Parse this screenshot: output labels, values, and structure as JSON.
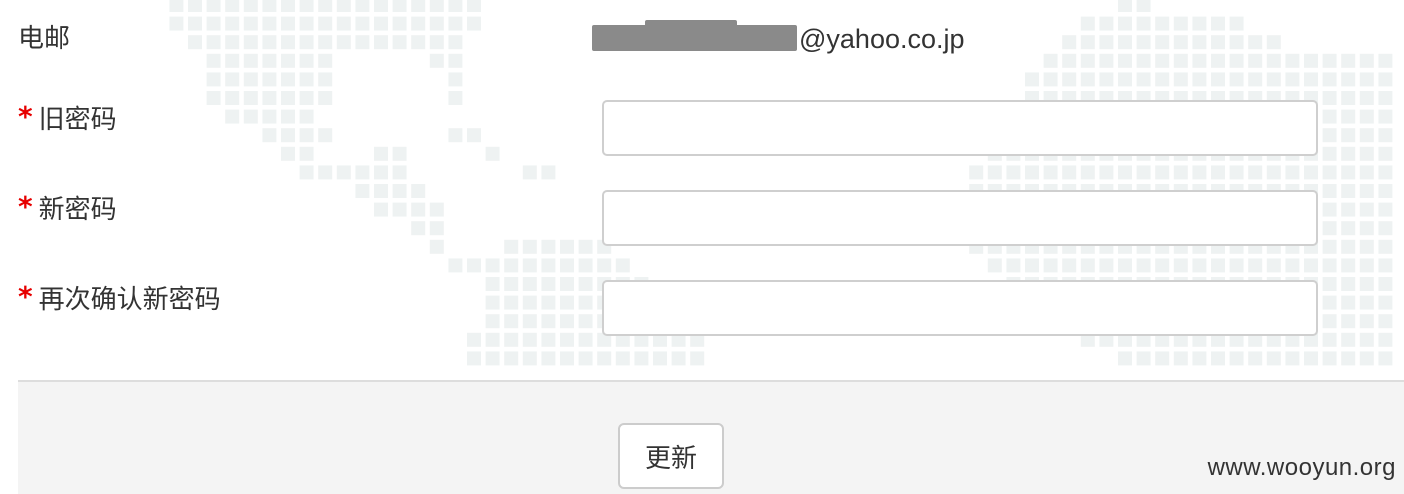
{
  "form": {
    "email": {
      "label": "电邮",
      "value_visible_suffix": "@yahoo.co.jp"
    },
    "old_password": {
      "required_mark": "*",
      "label": "旧密码",
      "value": ""
    },
    "new_password": {
      "required_mark": "*",
      "label": "新密码",
      "value": ""
    },
    "confirm_password": {
      "required_mark": "*",
      "label": "再次确认新密码",
      "value": ""
    }
  },
  "footer": {
    "update_button_label": "更新"
  },
  "watermark": "www.wooyun.org",
  "colors": {
    "required": "#e60000",
    "text": "#333333",
    "field_border": "#cfcfcf",
    "footer_bg": "#f4f4f4",
    "background_pattern": "#eef2f2",
    "redaction": "#8a8a8a"
  }
}
